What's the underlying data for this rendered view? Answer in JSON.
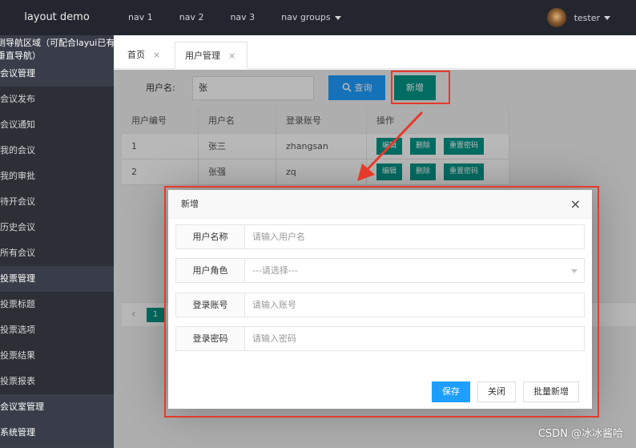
{
  "header": {
    "logo": "layout demo",
    "nav": [
      {
        "label": "nav 1"
      },
      {
        "label": "nav 2"
      },
      {
        "label": "nav 3"
      },
      {
        "label": "nav groups"
      }
    ],
    "user_name": "tester"
  },
  "sidebar": {
    "area_title_line1": "侧导航区域（可配合layui已有",
    "area_title_line2": "垂直导航）",
    "groups": [
      {
        "label": "会议管理",
        "items": [
          "会议发布",
          "会议通知",
          "我的会议",
          "我的审批",
          "待开会议",
          "历史会议",
          "所有会议"
        ]
      },
      {
        "label": "投票管理",
        "items": [
          "投票标题",
          "投票选项",
          "投票结果",
          "投票报表"
        ]
      },
      {
        "label": "会议室管理",
        "items": []
      },
      {
        "label": "系统管理",
        "items": []
      }
    ]
  },
  "tabs": [
    {
      "label": "首页",
      "close": "×"
    },
    {
      "label": "用户管理",
      "close": "×"
    }
  ],
  "search": {
    "label": "用户名:",
    "value": "张",
    "query_label": "查询",
    "add_label": "新增"
  },
  "table": {
    "headers": [
      "用户编号",
      "用户名",
      "登录账号",
      "操作"
    ],
    "rows": [
      {
        "id": "1",
        "name": "张三",
        "account": "zhangsan"
      },
      {
        "id": "2",
        "name": "张强",
        "account": "zq"
      }
    ],
    "actions": {
      "edit": "编辑",
      "delete": "删除",
      "reset": "重置密码"
    }
  },
  "pager": {
    "prev": "‹",
    "current": "1"
  },
  "dialog": {
    "title": "新增",
    "close": "×",
    "fields": [
      {
        "label": "用户名称",
        "placeholder": "请输入用户名"
      },
      {
        "label": "用户角色",
        "placeholder": "---请选择---"
      },
      {
        "label": "登录账号",
        "placeholder": "请输入账号"
      },
      {
        "label": "登录密码",
        "placeholder": "请输入密码"
      }
    ],
    "buttons": {
      "save": "保存",
      "close": "关闭",
      "batch_add": "批量新增"
    }
  },
  "watermark": "CSDN @冰冰酱哈",
  "colors": {
    "primary": "#1e9fff",
    "green": "#009688",
    "highlight": "#e53a2a",
    "header": "#23262e"
  }
}
